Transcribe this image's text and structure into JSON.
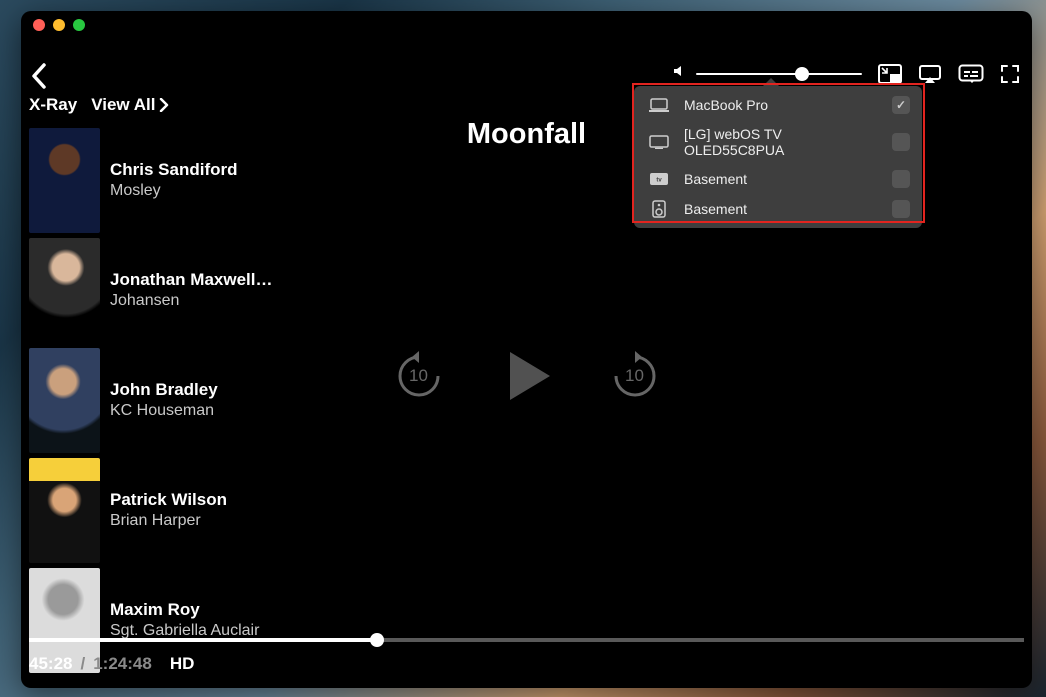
{
  "window": {
    "traffic": [
      "close",
      "minimize",
      "maximize"
    ]
  },
  "header": {
    "xray_label": "X-Ray",
    "view_all_label": "View All"
  },
  "movie": {
    "title": "Moonfall"
  },
  "cast": [
    {
      "name": "Chris Sandiford",
      "role": "Mosley"
    },
    {
      "name": "Jonathan Maxwell…",
      "role": "Johansen"
    },
    {
      "name": "John Bradley",
      "role": "KC Houseman"
    },
    {
      "name": "Patrick Wilson",
      "role": "Brian Harper"
    },
    {
      "name": "Maxim Roy",
      "role": "Sgt. Gabriella Auclair"
    }
  ],
  "playback": {
    "skip_back_seconds": "10",
    "skip_fwd_seconds": "10",
    "current_time": "45:28",
    "separator": "/",
    "total_time": "1:24:48",
    "quality_badge": "HD",
    "progress_percent": 35,
    "volume_percent": 64
  },
  "airplay": {
    "devices": [
      {
        "icon": "laptop-icon",
        "label": "MacBook Pro",
        "selected": true
      },
      {
        "icon": "tv-icon",
        "label": "[LG] webOS TV OLED55C8PUA",
        "selected": false
      },
      {
        "icon": "appletv-icon",
        "label": "Basement",
        "selected": false
      },
      {
        "icon": "speaker-icon",
        "label": "Basement",
        "selected": false
      }
    ]
  }
}
